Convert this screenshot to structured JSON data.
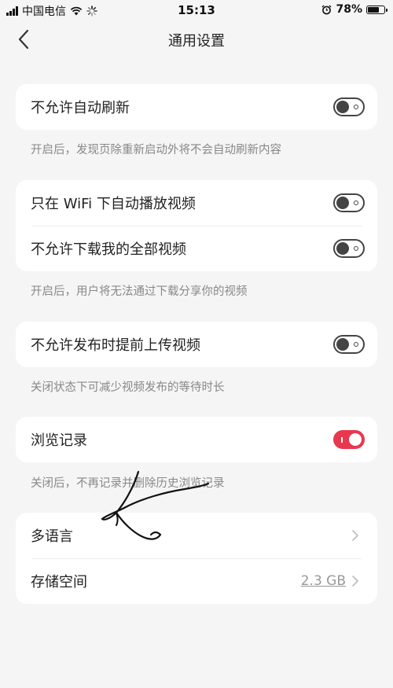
{
  "status_bar": {
    "carrier": "中国电信",
    "time": "15:13",
    "battery": "78%",
    "battery_level": 0.78
  },
  "nav": {
    "title": "通用设置",
    "back_icon": "chevron-left-icon"
  },
  "sections": [
    {
      "rows": [
        {
          "label": "不允许自动刷新",
          "toggle": "off"
        }
      ],
      "note": "开启后，发现页除重新启动外将不会自动刷新内容"
    },
    {
      "rows": [
        {
          "label": "只在 WiFi 下自动播放视频",
          "toggle": "off"
        },
        {
          "label": "不允许下载我的全部视频",
          "toggle": "off"
        }
      ],
      "note": "开启后，用户将无法通过下载分享你的视频"
    },
    {
      "rows": [
        {
          "label": "不允许发布时提前上传视频",
          "toggle": "off"
        }
      ],
      "note": "关闭状态下可减少视频发布的等待时长"
    },
    {
      "rows": [
        {
          "label": "浏览记录",
          "toggle": "on"
        }
      ],
      "note": "关闭后，不再记录并删除历史浏览记录"
    },
    {
      "rows": [
        {
          "label": "多语言",
          "value": "",
          "icon": "chevron-right-icon"
        },
        {
          "label": "存储空间",
          "value": "2.3 GB",
          "icon": "chevron-right-icon"
        }
      ]
    }
  ],
  "colors": {
    "accent": "#e8384f",
    "background": "#f5f5f5",
    "card": "#ffffff",
    "note_text": "#888888"
  }
}
